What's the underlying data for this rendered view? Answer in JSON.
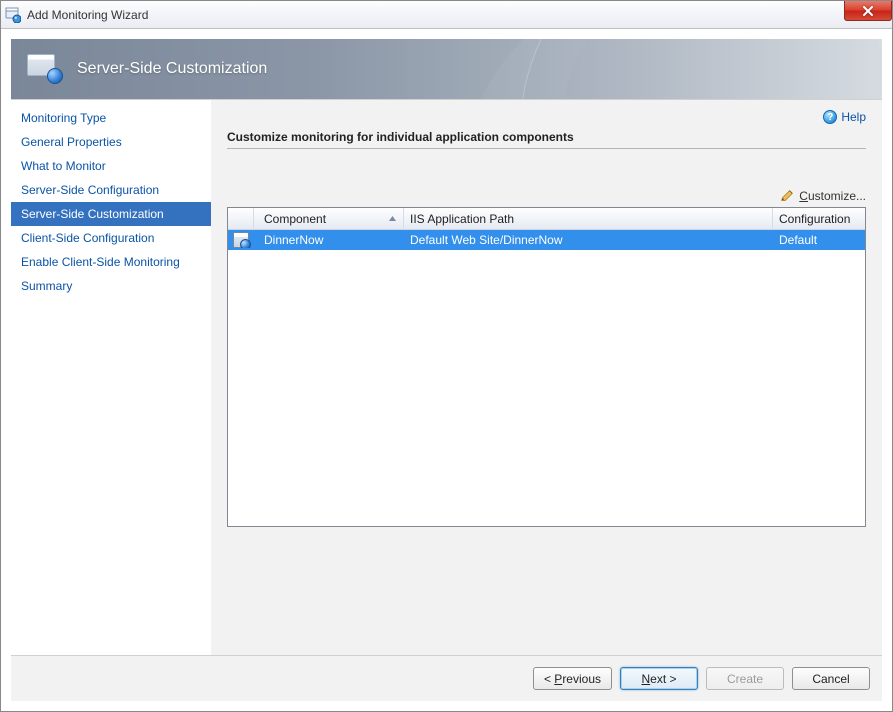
{
  "window": {
    "title": "Add Monitoring Wizard"
  },
  "banner": {
    "title": "Server-Side Customization"
  },
  "sidebar": {
    "items": [
      {
        "label": "Monitoring Type"
      },
      {
        "label": "General Properties"
      },
      {
        "label": "What to Monitor"
      },
      {
        "label": "Server-Side Configuration"
      },
      {
        "label": "Server-Side Customization"
      },
      {
        "label": "Client-Side Configuration"
      },
      {
        "label": "Enable Client-Side Monitoring"
      },
      {
        "label": "Summary"
      }
    ],
    "selected_index": 4
  },
  "content": {
    "help_label": "Help",
    "section_title": "Customize monitoring for individual application components",
    "customize_label": "Customize...",
    "grid": {
      "columns": {
        "component": "Component",
        "path": "IIS Application Path",
        "configuration": "Configuration"
      },
      "rows": [
        {
          "component": "DinnerNow",
          "path": "Default Web Site/DinnerNow",
          "configuration": "Default"
        }
      ]
    }
  },
  "footer": {
    "previous": "Previous",
    "next": "Next >",
    "create": "Create",
    "cancel": "Cancel"
  }
}
